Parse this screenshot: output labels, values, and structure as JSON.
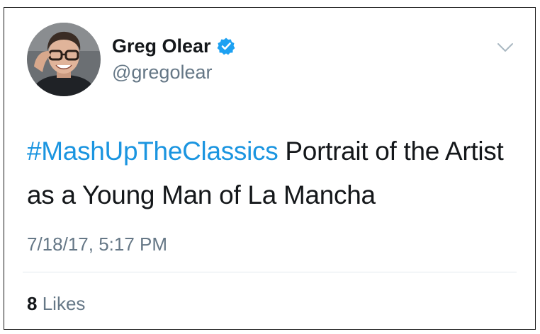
{
  "author": {
    "name": "Greg Olear",
    "handle": "@gregolear",
    "verified": true,
    "avatar_icon": "profile-photo"
  },
  "menu": {
    "icon": "chevron-down-icon"
  },
  "tweet": {
    "hashtag": "#MashUpTheClassics",
    "text": " Portrait of the Artist as a Young Man of La Mancha"
  },
  "timestamp": "7/18/17, 5:17 PM",
  "stats": {
    "likes_count": "8",
    "likes_label": "Likes"
  },
  "colors": {
    "link": "#1b95e0",
    "verified_badge": "#1da1f2",
    "secondary_text": "#657786",
    "primary_text": "#14171a"
  }
}
